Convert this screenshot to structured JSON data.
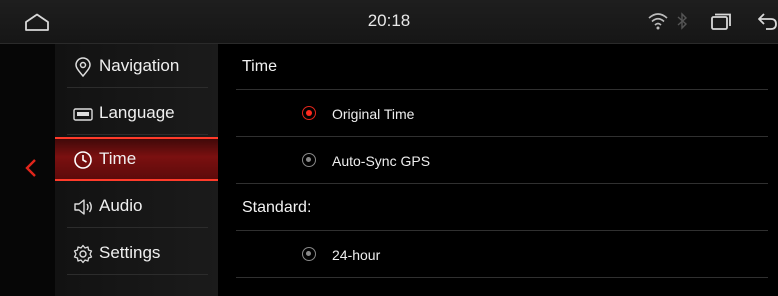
{
  "statusbar": {
    "time": "20:18",
    "icons": [
      "home-icon",
      "wifi-icon",
      "bluetooth-icon",
      "window-icon",
      "back-icon"
    ]
  },
  "sidebar": {
    "items": [
      {
        "label": "Navigation",
        "icon": "location-pin-icon",
        "active": false
      },
      {
        "label": "Language",
        "icon": "keyboard-icon",
        "active": false
      },
      {
        "label": "Time",
        "icon": "clock-icon",
        "active": true
      },
      {
        "label": "Audio",
        "icon": "speaker-icon",
        "active": false
      },
      {
        "label": "Settings",
        "icon": "gear-icon",
        "active": false
      }
    ]
  },
  "content": {
    "time_section": {
      "title": "Time",
      "options": [
        {
          "label": "Original Time",
          "selected": true
        },
        {
          "label": "Auto-Sync GPS",
          "selected": false
        }
      ]
    },
    "standard_section": {
      "title": "Standard:",
      "options": [
        {
          "label": "24-hour",
          "selected": false
        }
      ]
    }
  },
  "colors": {
    "accent": "#e0251b",
    "active_background": "#7b1010",
    "background": "#000000"
  }
}
